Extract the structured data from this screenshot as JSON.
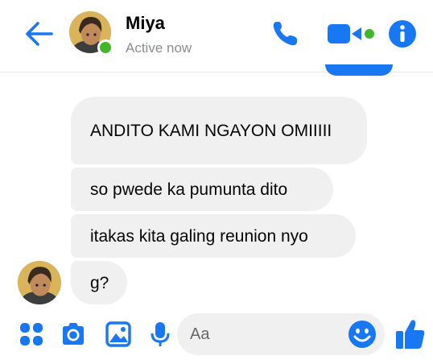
{
  "header": {
    "contact_name": "Miya",
    "status": "Active now",
    "icons": [
      "back-arrow-icon",
      "phone-icon",
      "video-camera-icon",
      "info-icon"
    ]
  },
  "messages": [
    {
      "text": "ANDITO KAMI NGAYON OMIIIII"
    },
    {
      "text": "so pwede ka pumunta dito"
    },
    {
      "text": "itakas kita galing reunion nyo"
    },
    {
      "text": "g?"
    }
  ],
  "composer": {
    "placeholder": "Aa",
    "icons": [
      "menu-dots-icon",
      "camera-icon",
      "image-icon",
      "microphone-icon",
      "emoji-icon",
      "thumbs-up-icon"
    ]
  },
  "colors": {
    "accent": "#1877f2",
    "online": "#42b72a",
    "bubble_bg": "#f0f0f0",
    "secondary_text": "#8a8d91"
  }
}
